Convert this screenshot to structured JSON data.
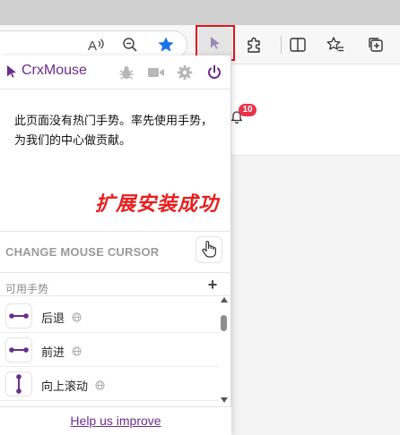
{
  "browser": {
    "extension_button_highlight_color": "#e0141a"
  },
  "page": {
    "notification_count": "10"
  },
  "popup": {
    "brand_name": "CrxMouse",
    "brand_color": "#6b2d8a",
    "header_icons": [
      "bug-icon",
      "video-camera-icon",
      "gear-icon",
      "power-icon"
    ],
    "message": "此页面没有热门手势。率先使用手势，为我们的中心做贡献。",
    "success_banner": "扩展安装成功",
    "success_color": "#e81e1e",
    "cursor_section_title": "CHANGE MOUSE CURSOR",
    "available_gestures_label": "可用手势",
    "add_label": "+",
    "gestures": [
      {
        "label": "后退",
        "icon": "arrow-left-gesture-icon"
      },
      {
        "label": "前进",
        "icon": "arrow-right-gesture-icon"
      },
      {
        "label": "向上滚动",
        "icon": "arrow-up-gesture-icon"
      }
    ],
    "footer_link": "Help us improve"
  }
}
